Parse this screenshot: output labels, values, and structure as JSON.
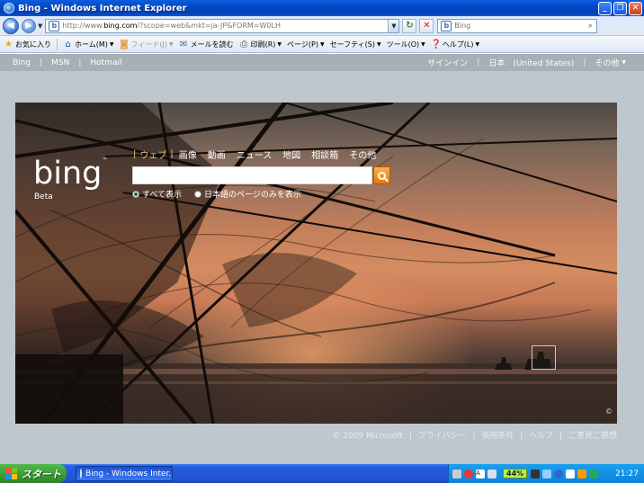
{
  "window": {
    "title": "Bing - Windows Internet Explorer"
  },
  "address_bar": {
    "url_prefix": "http://www.",
    "url_domain": "bing.com",
    "url_rest": "/?scope=web&mkt=ja-JP&FORM=W0LH",
    "search_placeholder": "Bing"
  },
  "command_bar": {
    "favorites": "お気に入り",
    "home": "ホーム(M)",
    "feeds": "フィード(J)",
    "read_mail": "メールを読む",
    "print": "印刷(R)",
    "page": "ページ(P)",
    "safety": "セーフティ(S)",
    "tools": "ツール(O)",
    "help": "ヘルプ(L)"
  },
  "top_nav": {
    "left": [
      "Bing",
      "MSN",
      "Hotmail"
    ],
    "sign_in": "サインイン",
    "region": "日本　(United States)",
    "more": "その他"
  },
  "brand": {
    "logo": "bing",
    "beta": "Beta"
  },
  "search_tabs": [
    "ウェブ",
    "画像",
    "動画",
    "ニュース",
    "地図",
    "相談箱",
    "その他"
  ],
  "search_options": {
    "all": "すべて表示",
    "japanese_only": "日本語のページのみを表示"
  },
  "footer": {
    "copyright": "© 2009 Microsoft",
    "privacy": "プライバシー",
    "terms": "使用条件",
    "help": "ヘルプ",
    "feedback": "ご意見ご感想"
  },
  "taskbar": {
    "start": "スタート",
    "task": "Bing - Windows Inter...",
    "battery": "44%",
    "clock": "21:27"
  },
  "colors": {
    "xp_blue": "#0447c4",
    "bing_orange": "#e7770a",
    "active_tab": "#f0c070"
  }
}
